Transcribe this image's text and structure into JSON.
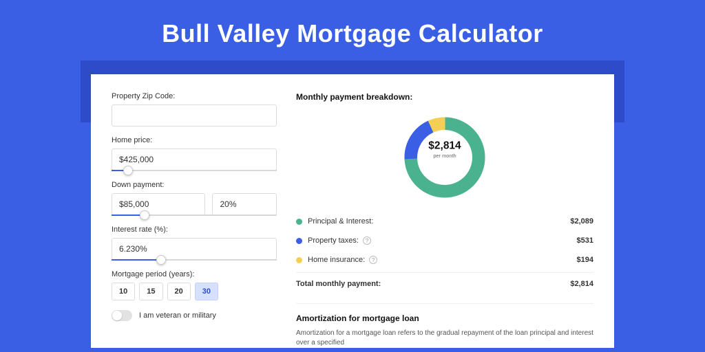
{
  "hero": {
    "title": "Bull Valley Mortgage Calculator"
  },
  "form": {
    "zip": {
      "label": "Property Zip Code:",
      "value": ""
    },
    "homePrice": {
      "label": "Home price:",
      "value": "$425,000",
      "sliderPercent": 10
    },
    "downPayment": {
      "label": "Down payment:",
      "amount": "$85,000",
      "percent": "20%",
      "sliderPercent": 20
    },
    "interestRate": {
      "label": "Interest rate (%):",
      "value": "6.230%",
      "sliderPercent": 30
    },
    "period": {
      "label": "Mortgage period (years):",
      "options": [
        "10",
        "15",
        "20",
        "30"
      ],
      "active": "30"
    },
    "veteran": {
      "label": "I am veteran or military",
      "on": false
    }
  },
  "breakdown": {
    "title": "Monthly payment breakdown:",
    "centerAmount": "$2,814",
    "centerSub": "per month",
    "items": [
      {
        "label": "Principal & Interest:",
        "value": "$2,089",
        "color": "#4bb28f",
        "info": false
      },
      {
        "label": "Property taxes:",
        "value": "$531",
        "color": "#3a5fe5",
        "info": true
      },
      {
        "label": "Home insurance:",
        "value": "$194",
        "color": "#f3cf55",
        "info": true
      }
    ],
    "totalLabel": "Total monthly payment:",
    "totalValue": "$2,814"
  },
  "chart_data": {
    "type": "pie",
    "title": "Monthly payment breakdown",
    "series": [
      {
        "name": "Principal & Interest",
        "value": 2089,
        "color": "#4bb28f"
      },
      {
        "name": "Property taxes",
        "value": 531,
        "color": "#3a5fe5"
      },
      {
        "name": "Home insurance",
        "value": 194,
        "color": "#f3cf55"
      }
    ],
    "total": 2814,
    "center_label": "$2,814 per month"
  },
  "amort": {
    "title": "Amortization for mortgage loan",
    "text": "Amortization for a mortgage loan refers to the gradual repayment of the loan principal and interest over a specified"
  }
}
